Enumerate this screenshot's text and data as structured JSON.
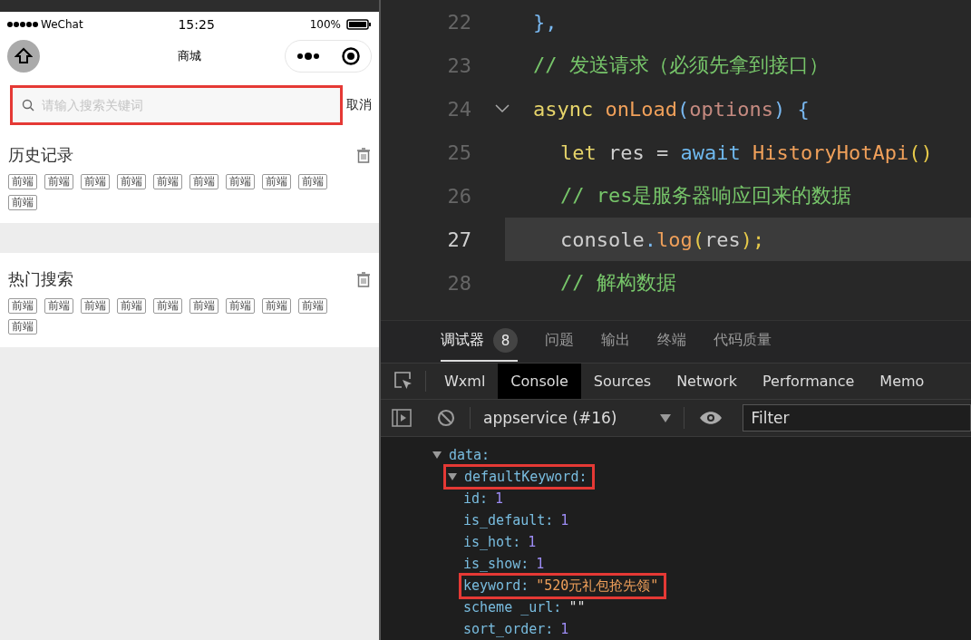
{
  "phone": {
    "status_bar": {
      "carrier": "WeChat",
      "time": "15:25",
      "battery": "100%"
    },
    "nav": {
      "title": "商城"
    },
    "search": {
      "placeholder": "请输入搜索关键词",
      "highlighted": true,
      "cancel": "取消"
    },
    "sections": [
      {
        "title": "历史记录",
        "tags": [
          "前端",
          "前端",
          "前端",
          "前端",
          "前端",
          "前端",
          "前端",
          "前端",
          "前端",
          "前端"
        ]
      },
      {
        "title": "热门搜索",
        "tags": [
          "前端",
          "前端",
          "前端",
          "前端",
          "前端",
          "前端",
          "前端",
          "前端",
          "前端",
          "前端"
        ]
      }
    ]
  },
  "editor": {
    "lines": [
      {
        "number": "22",
        "current": false,
        "tokens": [
          {
            "text": "},",
            "kind": "brace"
          }
        ]
      },
      {
        "number": "23",
        "current": false,
        "tokens": [
          {
            "text": "// 发送请求（必须先拿到接口）",
            "kind": "comment"
          }
        ]
      },
      {
        "number": "24",
        "current": false,
        "expanded": true,
        "tokens": [
          {
            "text": "async ",
            "kind": "keyword"
          },
          {
            "text": "onLoad",
            "kind": "func"
          },
          {
            "text": "(",
            "kind": "brace"
          },
          {
            "text": "options",
            "kind": "param"
          },
          {
            "text": ") {",
            "kind": "brace"
          }
        ],
        "children": [
          {
            "number": "25",
            "current": false,
            "tokens": [
              {
                "text": "let ",
                "kind": "keyword"
              },
              {
                "text": "res = ",
                "kind": "plain"
              },
              {
                "text": "await ",
                "kind": "await"
              },
              {
                "text": "HistoryHotApi",
                "kind": "func"
              },
              {
                "text": "()",
                "kind": "paren"
              }
            ]
          },
          {
            "number": "26",
            "current": false,
            "tokens": [
              {
                "text": "// res是服务器响应回来的数据",
                "kind": "comment"
              }
            ]
          },
          {
            "number": "27",
            "current": true,
            "tokens": [
              {
                "text": "console",
                "kind": "plain"
              },
              {
                "text": ".",
                "kind": "brace"
              },
              {
                "text": "log",
                "kind": "func"
              },
              {
                "text": "(",
                "kind": "paren"
              },
              {
                "text": "res",
                "kind": "plain"
              },
              {
                "text": ");",
                "kind": "paren"
              }
            ]
          },
          {
            "number": "28",
            "current": false,
            "tokens": [
              {
                "text": "// 解构数据",
                "kind": "comment"
              }
            ]
          }
        ]
      }
    ]
  },
  "panel_tabs": [
    {
      "label": "调试器",
      "selected": true,
      "badge": "8"
    },
    {
      "label": "问题",
      "selected": false
    },
    {
      "label": "输出",
      "selected": false
    },
    {
      "label": "终端",
      "selected": false
    },
    {
      "label": "代码质量",
      "selected": false
    }
  ],
  "devtools_tabs": [
    {
      "label": "Wxml",
      "selected": false
    },
    {
      "label": "Console",
      "selected": true
    },
    {
      "label": "Sources",
      "selected": false
    },
    {
      "label": "Network",
      "selected": false
    },
    {
      "label": "Performance",
      "selected": false
    },
    {
      "label": "Memo",
      "selected": false
    }
  ],
  "console_toolbar": {
    "context": "appservice (#16)",
    "filter_placeholder": "Filter"
  },
  "console": [
    {
      "key": "data:",
      "expanded": true,
      "highlighted": false,
      "children": [
        {
          "key": "defaultKeyword:",
          "expanded": true,
          "highlighted": true,
          "children": [
            {
              "key": "id:",
              "value": "1",
              "kind": "number",
              "highlighted": false
            },
            {
              "key": "is_default:",
              "value": "1",
              "kind": "number",
              "highlighted": false
            },
            {
              "key": "is_hot:",
              "value": "1",
              "kind": "number",
              "highlighted": false
            },
            {
              "key": "is_show:",
              "value": "1",
              "kind": "number",
              "highlighted": false
            },
            {
              "key": "keyword:",
              "value": "\"520元礼包抢先领\"",
              "kind": "string",
              "highlighted": true
            },
            {
              "key": "scheme _url:",
              "value": "\"\"",
              "kind": "empty",
              "highlighted": false
            },
            {
              "key": "sort_order:",
              "value": "1",
              "kind": "number",
              "highlighted": false
            }
          ]
        }
      ]
    }
  ]
}
